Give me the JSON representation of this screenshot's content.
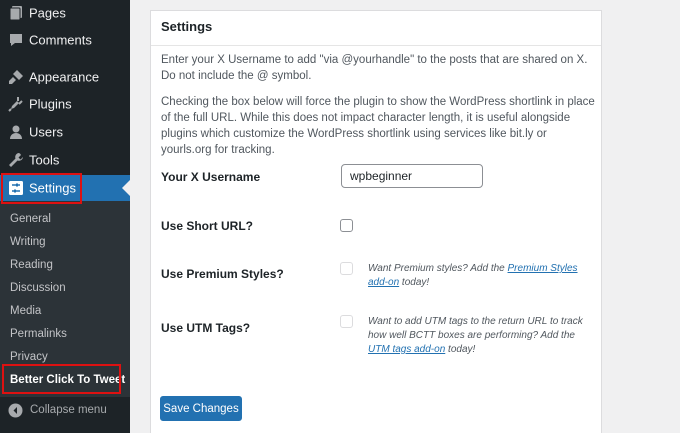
{
  "sidebar": {
    "menu": [
      {
        "label": "Pages",
        "icon": "pages-icon"
      },
      {
        "label": "Comments",
        "icon": "comments-icon"
      },
      {
        "label": "Appearance",
        "icon": "appearance-icon"
      },
      {
        "label": "Plugins",
        "icon": "plugins-icon"
      },
      {
        "label": "Users",
        "icon": "users-icon"
      },
      {
        "label": "Tools",
        "icon": "tools-icon"
      },
      {
        "label": "Settings",
        "icon": "settings-icon"
      }
    ],
    "submenu": [
      "General",
      "Writing",
      "Reading",
      "Discussion",
      "Media",
      "Permalinks",
      "Privacy",
      "Better Click To Tweet"
    ],
    "collapse_label": "Collapse menu"
  },
  "panel": {
    "title": "Settings",
    "description_1": "Enter your X Username to add \"via @yourhandle\" to the posts that are shared on X. Do not include the @ symbol.",
    "description_2": "Checking the box below will force the plugin to show the WordPress shortlink in place of the full URL. While this does not impact character length, it is useful alongside plugins which customize the WordPress shortlink using services like bit.ly or yourls.org for tracking.",
    "username_label": "Your X Username",
    "username_value": "wpbeginner",
    "short_url_label": "Use Short URL?",
    "premium_label": "Use Premium Styles?",
    "premium_note_text": "Want Premium styles? Add the ",
    "premium_note_link": "Premium Styles add-on",
    "premium_note_end": " today!",
    "utm_label": "Use UTM Tags?",
    "utm_note_text": "Want to add UTM tags to the return URL to track how well BCTT boxes are performing? Add the ",
    "utm_note_link": "UTM tags add-on",
    "utm_note_end": " today!",
    "save_label": "Save Changes"
  },
  "colors": {
    "sidebar_bg": "#1d2327",
    "submenu_bg": "#2c3338",
    "accent": "#2271b1",
    "highlight": "#dd1111"
  }
}
